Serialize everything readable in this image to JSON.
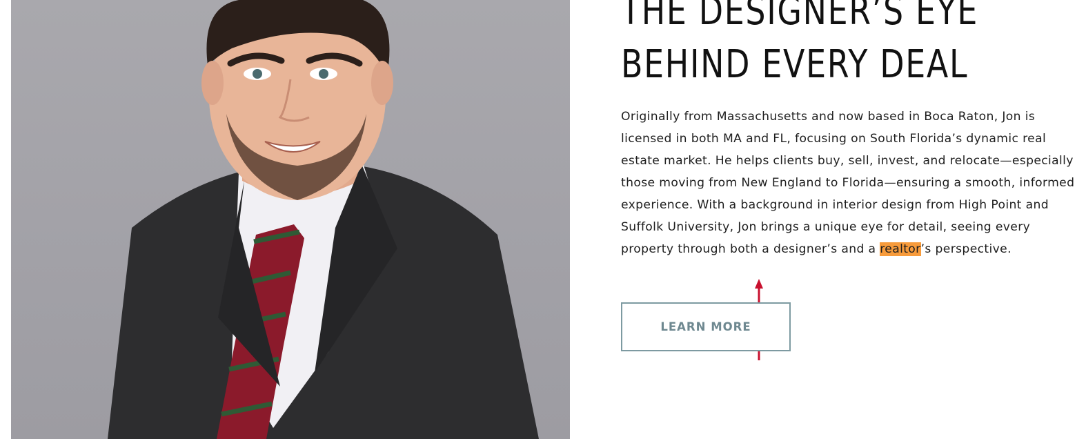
{
  "hero": {
    "headline_line1": "THE DESIGNER’S EYE",
    "headline_line2": "BEHIND EVERY DEAL",
    "bio_before": "Originally from Massachusetts and now based in Boca Raton, Jon is licensed in both MA and FL, focusing on South Florida’s dynamic real estate market. He helps clients buy, sell, invest, and relocate—especially those moving from New England to Florida—ensuring a smooth, informed experience. With a background in interior design from High Point and Suffolk University, Jon brings a unique eye for detail, seeing every property through both a designer’s and a ",
    "bio_highlight": "realtor",
    "bio_after": "’s perspective.",
    "button_label": "LEARN MORE"
  },
  "colors": {
    "highlight": "#f79b3b",
    "button_border": "#7d9aa1",
    "button_text": "#6e8890",
    "annotation_arrow": "#c8102e",
    "photo_background": "#a3a2a8"
  }
}
